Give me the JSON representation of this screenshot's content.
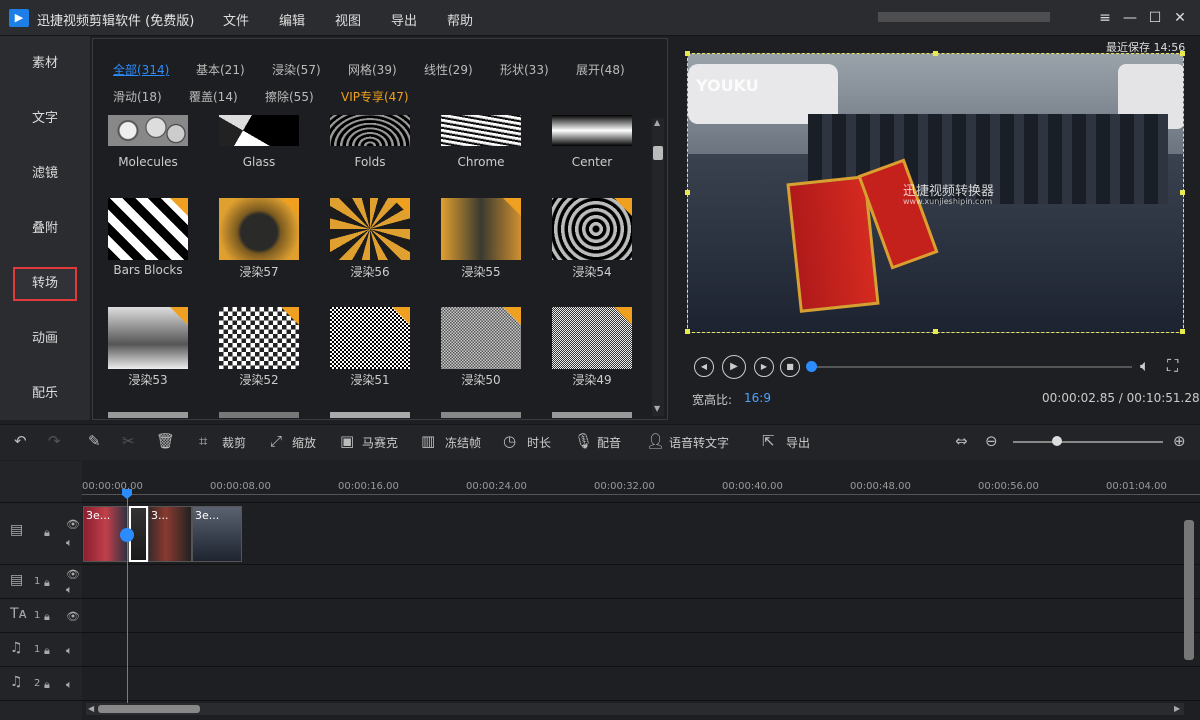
{
  "titlebar": {
    "logo": "▶",
    "title": "迅捷视频剪辑软件 (免费版)",
    "menus": [
      "文件",
      "编辑",
      "视图",
      "导出",
      "帮助"
    ],
    "controls": {
      "menu": "≡",
      "minimize": "—",
      "maximize": "☐",
      "close": "✕"
    }
  },
  "sidebar": {
    "items": [
      {
        "label": "素材"
      },
      {
        "label": "文字"
      },
      {
        "label": "滤镜"
      },
      {
        "label": "叠附"
      },
      {
        "label": "转场",
        "active": true
      },
      {
        "label": "动画"
      },
      {
        "label": "配乐"
      }
    ],
    "active_color": "#e03a3a"
  },
  "transitions": {
    "categories": [
      {
        "label": "全部(314)",
        "active": true
      },
      {
        "label": "基本(21)"
      },
      {
        "label": "浸染(57)"
      },
      {
        "label": "网格(39)"
      },
      {
        "label": "线性(29)"
      },
      {
        "label": "形状(33)"
      },
      {
        "label": "展开(48)"
      },
      {
        "label": "滑动(18)"
      },
      {
        "label": "覆盖(14)"
      },
      {
        "label": "擦除(55)"
      },
      {
        "label": "VIP专享(47)",
        "vip": true
      }
    ],
    "rows": [
      [
        "Molecules",
        "Glass",
        "Folds",
        "Chrome",
        "Center"
      ],
      [
        "Bars Blocks",
        "浸染57",
        "浸染56",
        "浸染55",
        "浸染54"
      ],
      [
        "浸染53",
        "浸染52",
        "浸染51",
        "浸染50",
        "浸染49"
      ]
    ],
    "accent": "#2b8cff",
    "vip_color": "#f0a020"
  },
  "preview": {
    "save_label": "最近保存 14:56",
    "watermark_brand": "YOUKU",
    "watermark_text": "迅捷视频转换器",
    "watermark_url": "www.xunjieshipin.com",
    "aspect_label": "宽高比:",
    "aspect_value": "16:9",
    "time_readout": "00:00:02.85 / 00:10:51.28",
    "progress": 0.0044
  },
  "toolbar": {
    "items": [
      "裁剪",
      "缩放",
      "马赛克",
      "冻结帧",
      "时长",
      "配音",
      "语音转文字",
      "导出"
    ]
  },
  "timeline": {
    "ruler_ticks": [
      "00:00:00.00",
      "00:00:08.00",
      "00:00:16.00",
      "00:00:24.00",
      "00:00:32.00",
      "00:00:40.00",
      "00:00:48.00",
      "00:00:56.00",
      "00:01:04.00"
    ],
    "clips": [
      "3e...",
      "",
      "3...",
      "3e..."
    ],
    "track_numbers": [
      "1",
      "1",
      "1",
      "2"
    ]
  }
}
